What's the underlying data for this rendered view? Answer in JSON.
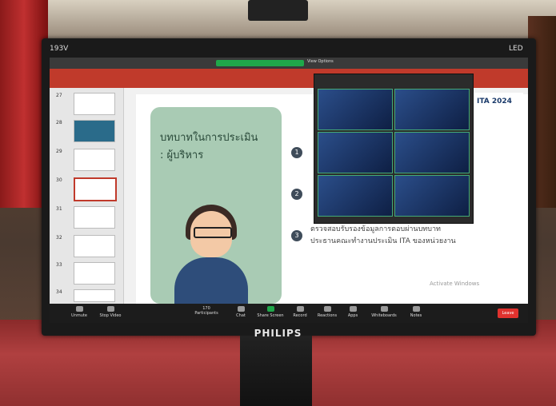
{
  "monitor": {
    "model": "193V",
    "led_label": "LED",
    "brand": "PHILIPS"
  },
  "slide_panel": {
    "slide_numbers": [
      "27",
      "28",
      "29",
      "30",
      "31",
      "32",
      "33",
      "34"
    ]
  },
  "slide": {
    "title_line1": "บทบาทในการประเมิน",
    "title_line2": ": ผู้บริหาร",
    "items": [
      {
        "num": "1",
        "text": ""
      },
      {
        "num": "2",
        "text": ""
      },
      {
        "num": "3",
        "text": "ตรวจสอบรับรองข้อมูลการตอบผ่านบทบาท"
      }
    ],
    "item3_line2": "ประธานคณะทำงานประเมิน ITA ของหน่วยงาน",
    "badge": "ITA 2024",
    "watermark": "Activate Windows"
  },
  "zoom_toolbar": {
    "unmute": "Unmute",
    "stop_video": "Stop Video",
    "participants": "Participants",
    "participants_count": "170",
    "chat": "Chat",
    "share_screen": "Share Screen",
    "record": "Record",
    "reactions": "Reactions",
    "apps": "Apps",
    "whiteboards": "Whiteboards",
    "notes": "Notes",
    "leave": "Leave"
  },
  "top_bar": {
    "view_options": "View Options"
  }
}
